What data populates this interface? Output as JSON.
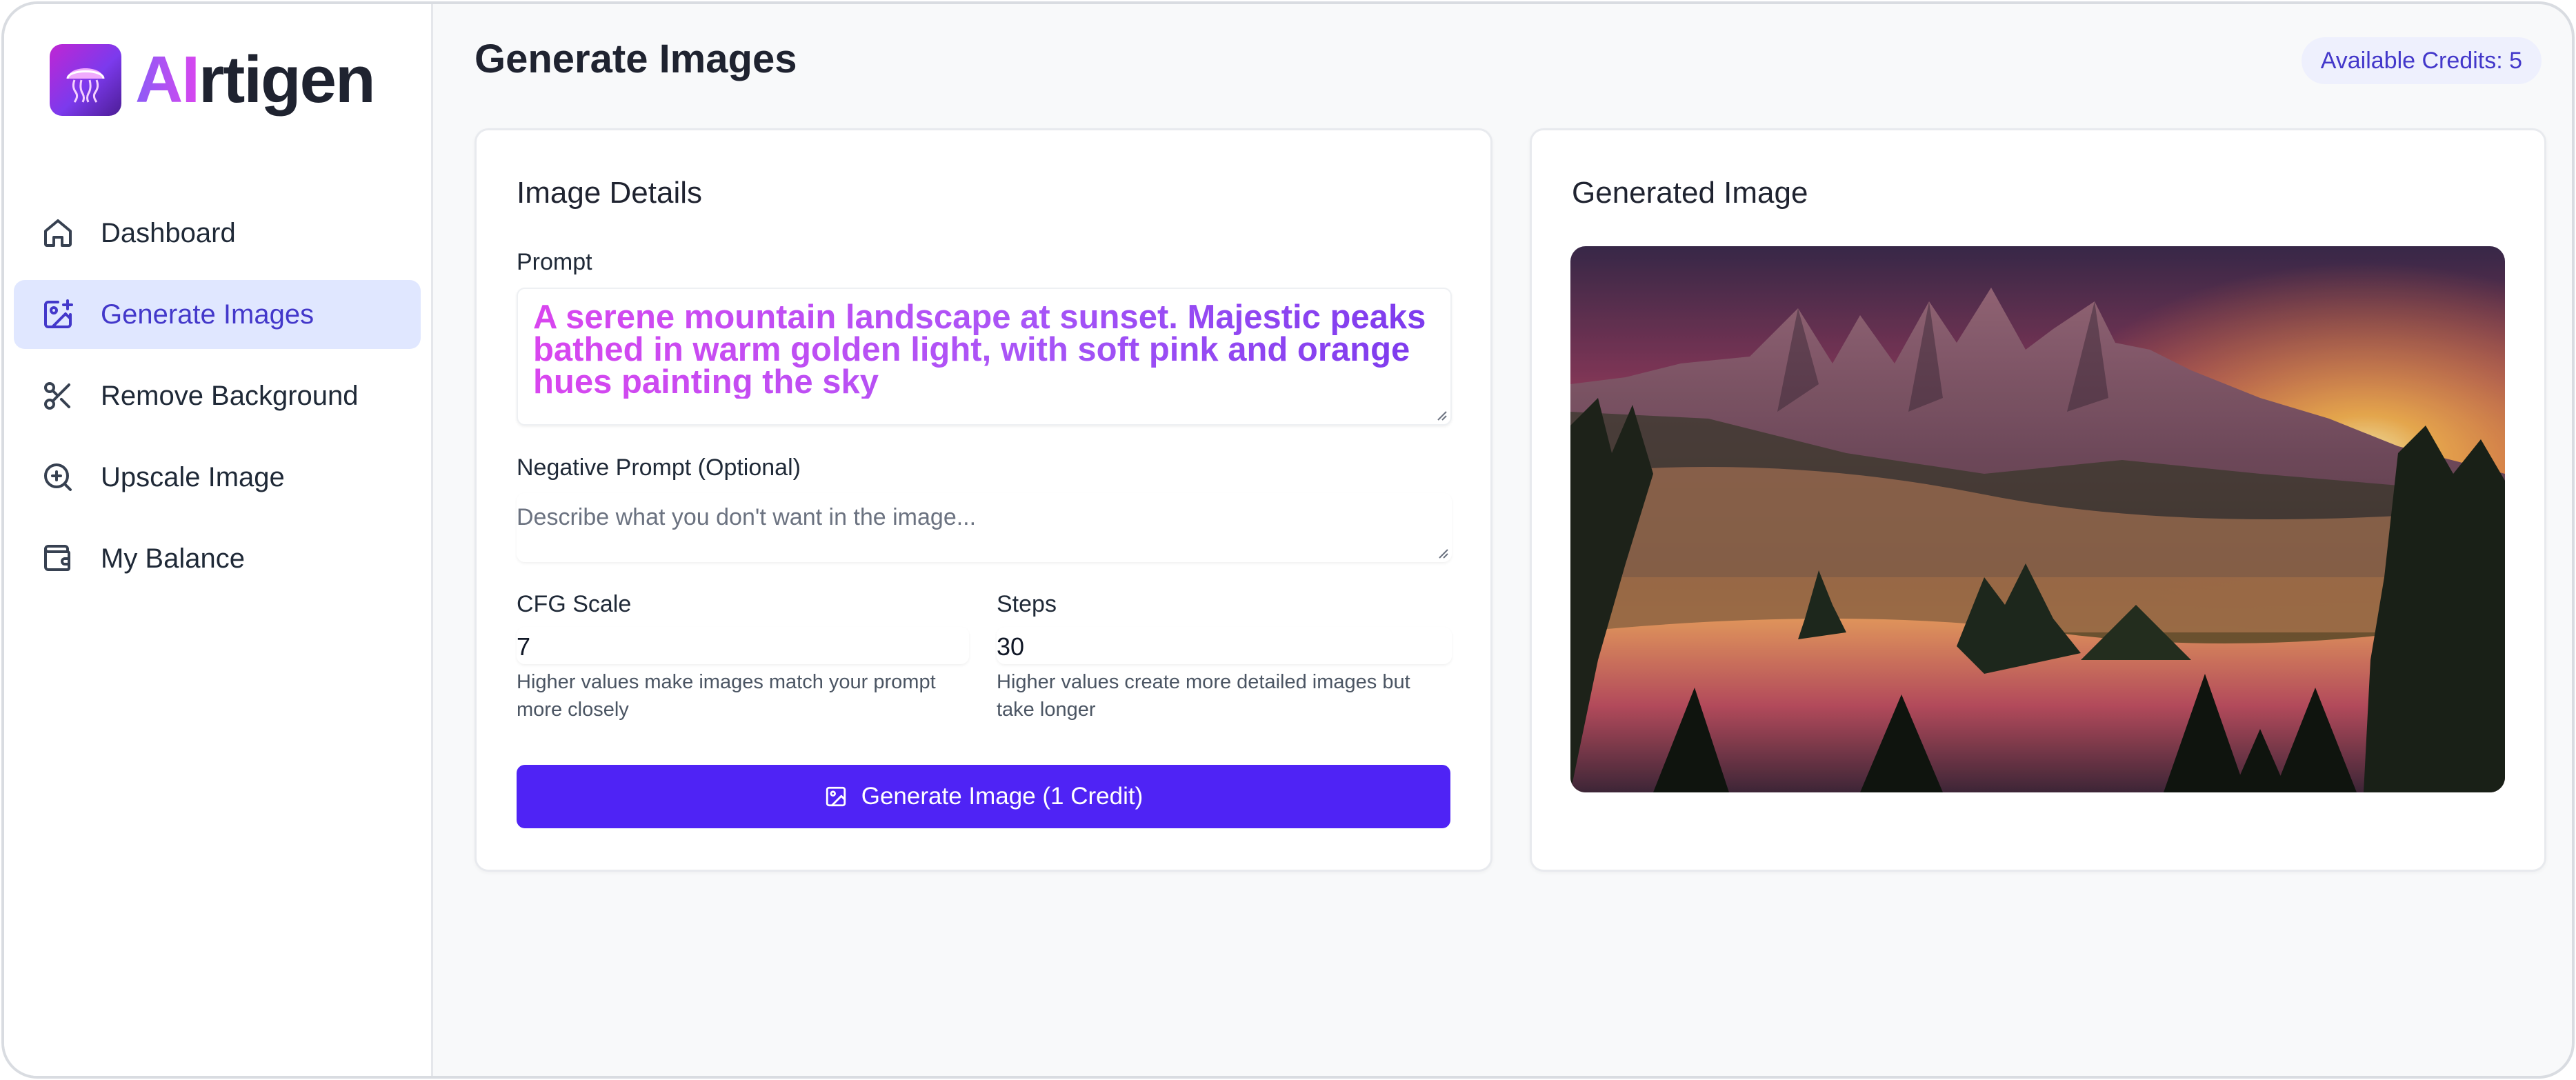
{
  "app": {
    "brand_prefix": "AI",
    "brand_suffix": "rtigen"
  },
  "sidebar": {
    "items": [
      {
        "label": "Dashboard",
        "icon": "home-icon",
        "active": false
      },
      {
        "label": "Generate Images",
        "icon": "image-plus-icon",
        "active": true
      },
      {
        "label": "Remove Background",
        "icon": "scissors-icon",
        "active": false
      },
      {
        "label": "Upscale Image",
        "icon": "zoom-in-icon",
        "active": false
      },
      {
        "label": "My Balance",
        "icon": "wallet-icon",
        "active": false
      }
    ]
  },
  "header": {
    "title": "Generate Images",
    "credits": "Available Credits: 5"
  },
  "details": {
    "title": "Image Details",
    "prompt_label": "Prompt",
    "prompt_value": "A serene mountain landscape at sunset. Majestic peaks bathed in warm golden light, with soft pink and orange hues painting the sky",
    "negative_label": "Negative Prompt (Optional)",
    "negative_placeholder": "Describe what you don't want in the image...",
    "cfg_label": "CFG Scale",
    "cfg_value": "7",
    "cfg_help": "Higher values make images match your prompt more closely",
    "steps_label": "Steps",
    "steps_value": "30",
    "steps_help": "Higher values create more detailed images but take longer",
    "generate_button": "Generate Image (1 Credit)"
  },
  "result": {
    "title": "Generated Image"
  },
  "colors": {
    "accent": "#4f23f5",
    "active_nav_bg": "#e0e7ff",
    "active_nav_text": "#4338ca",
    "brand_gradient_start": "#8b5cf6",
    "brand_gradient_end": "#d946ef"
  }
}
